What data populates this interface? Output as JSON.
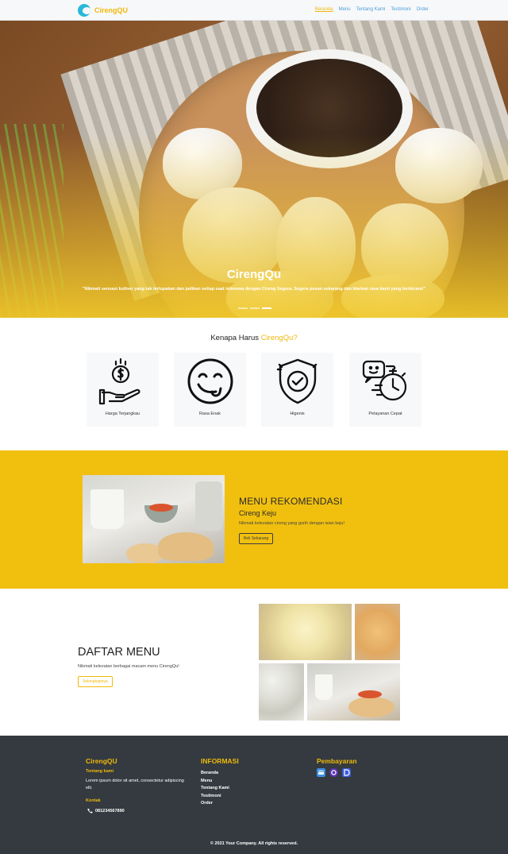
{
  "nav": {
    "brand": "CirengQU",
    "links": [
      "Beranda",
      "Menu",
      "Tentang Kami",
      "Testimoni",
      "Order"
    ],
    "active_link": "Beranda"
  },
  "hero": {
    "title": "CirengQu",
    "subtitle": "\"Nikmati sensasi kuliner yang tak terlupakan dan jadikan setiap saat istimewa dengan Cireng Segera. Segera pesan sekarang dan biarkan rasa kami yang berbicara!\"",
    "slides": 3,
    "active_slide": 2
  },
  "why": {
    "title_prefix": "Kenapa Harus",
    "title_accent": "CirengQu?",
    "features": [
      {
        "label": "Harga Terjangkau",
        "icon": "money-hand-icon"
      },
      {
        "label": "Rasa Enak",
        "icon": "tasty-face-icon"
      },
      {
        "label": "Higenis",
        "icon": "shield-check-icon"
      },
      {
        "label": "Pelayanan Cepat",
        "icon": "fast-service-icon"
      }
    ]
  },
  "recommendation": {
    "heading": "MENU REKOMENDASI",
    "name": "Cireng Keju",
    "description": "Nikmati kelezatan cireng yang gurih dengan isian keju!",
    "button": "Beli Sekarang"
  },
  "menu": {
    "heading": "DAFTAR MENU",
    "description": "Nikmati kelezatan berbagai macam menu CirengQu!",
    "button": "Selengkapnya"
  },
  "footer": {
    "brand": "CirengQU",
    "about_title": "Tentang kami",
    "about_text": "Lorem ipsum dolor sit amet, consectetur adipiscing elit.",
    "contact_title": "Kontak",
    "phone": "081234567890",
    "info_title": "INFORMASI",
    "info_links": [
      "Beranda",
      "Menu",
      "Tentang Kami",
      "Testimoni",
      "Order"
    ],
    "payment_title": "Pembayaran",
    "payment_icons": [
      {
        "icon": "bank-card-icon",
        "color": "#3a8fe0"
      },
      {
        "icon": "ovo-icon",
        "color": "#5c33b5"
      },
      {
        "icon": "dana-icon",
        "color": "#3b5bdb"
      }
    ],
    "copyright": "© 2021 Your Company. All rights reserved."
  },
  "colors": {
    "accent": "#f0b90b",
    "recommendation_bg": "#f1c00f",
    "footer_bg": "#343a40",
    "nav_link": "#4a9fd8"
  }
}
